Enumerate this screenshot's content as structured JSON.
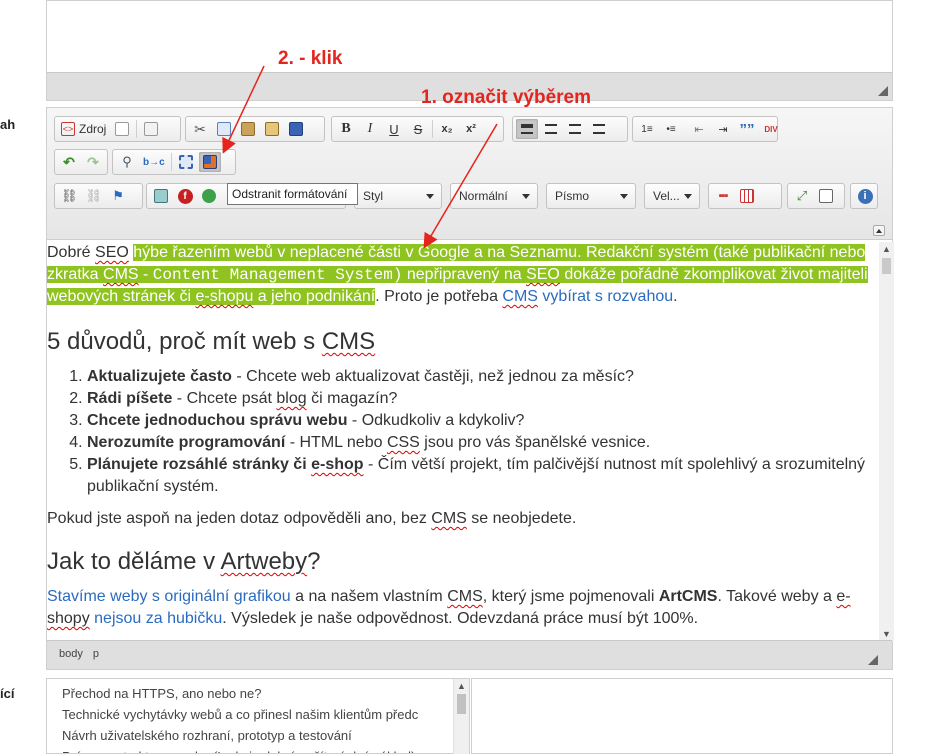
{
  "side_labels": {
    "a": "ah",
    "b": "ící"
  },
  "annotations": {
    "click": "2. - klik",
    "select": "1. označit výběrem"
  },
  "toolbar": {
    "source_label": "Zdroj",
    "bold": "B",
    "italic": "I",
    "underline": "U",
    "strike": "S",
    "subscript": "x₂",
    "superscript": "x²",
    "quote": "””",
    "div": "DIV",
    "tooltip": "Odstranit formátování",
    "style_combo": "Styl",
    "format_combo": "Normální",
    "font_combo": "Písmo",
    "size_combo": "Vel...",
    "info": "i"
  },
  "content": {
    "p1": {
      "t1": "Dobré ",
      "seo1": "SEO",
      "t2": " ",
      "hl1": "hýbe řazením webů v neplacené části v Google a na Seznamu. Redakční systém (také publikační nebo zkratka ",
      "hl_cms": "CMS",
      "hl2": " - ",
      "hl_mono": "Content Management System)",
      "hl3": " nepřipravený na ",
      "hl_seo": "SEO",
      "hl4": " dokáže pořádně zkomplikovat život majiteli webových stránek či ",
      "hl_eshop": "e-shopu",
      "hl5": " a jeho podnikání",
      "t3": ". Proto je potřeba ",
      "link_cms": "CMS",
      "link_rest": " vybírat s rozvahou",
      "t4": "."
    },
    "h1_text": "5 důvodů, proč mít web s ",
    "h1_cms": "CMS",
    "list": [
      {
        "b": "Aktualizujete často",
        "t": " - Chcete web aktualizovat častěji, než jednou za měsíc?"
      },
      {
        "b": "Rádi píšete",
        "t": " - Chcete psát ",
        "s": "blog",
        "t2": " či magazín?"
      },
      {
        "b": "Chcete jednoduchou správu webu",
        "t": " - Odkudkoliv a kdykoliv?"
      },
      {
        "b": "Nerozumíte programování",
        "t": " - HTML nebo ",
        "s": "CSS",
        "t2": " jsou pro vás španělské vesnice."
      },
      {
        "b": "Plánujete rozsáhlé stránky či ",
        "bs": "e-shop",
        "t": " - Čím větší projekt, tím palčivější nutnost mít spolehlivý a srozumitelný publikační systém."
      }
    ],
    "p2": {
      "t1": "Pokud jste aspoň na jeden dotaz odpověděli ano, bez ",
      "s": "CMS",
      "t2": " se neobjedete."
    },
    "h2_text": "Jak to děláme v ",
    "h2_art": "Artweby",
    "h2_q": "?",
    "p3": {
      "link1": "Stavíme weby s originální grafikou",
      "t1": " a na našem vlastním ",
      "s1": "CMS",
      "t2": ", který jsme pojmenovali ",
      "b1": "ArtCMS",
      "t3": ". Takové weby a ",
      "s2": "e-shopy",
      "t4": " ",
      "link2": "nejsou za hubičku",
      "t5": ". Výsledek je naše odpovědnost. Odevzdaná práce musí být 100%."
    }
  },
  "path": [
    "body",
    "p"
  ],
  "list_box": [
    "Přechod na HTTPS, ano nebo ne?",
    "Technické vychytávky webů a co přinesl našim klientům předc",
    "Návrh uživatelského rozhraní, prototyp a testování",
    "Práce se strukturou webu (Lzde je dobré začít - úplný základ)"
  ],
  "colors": {
    "highlight": "#8fc31f",
    "annotation": "#e4241d",
    "link": "#2a6bbf"
  }
}
